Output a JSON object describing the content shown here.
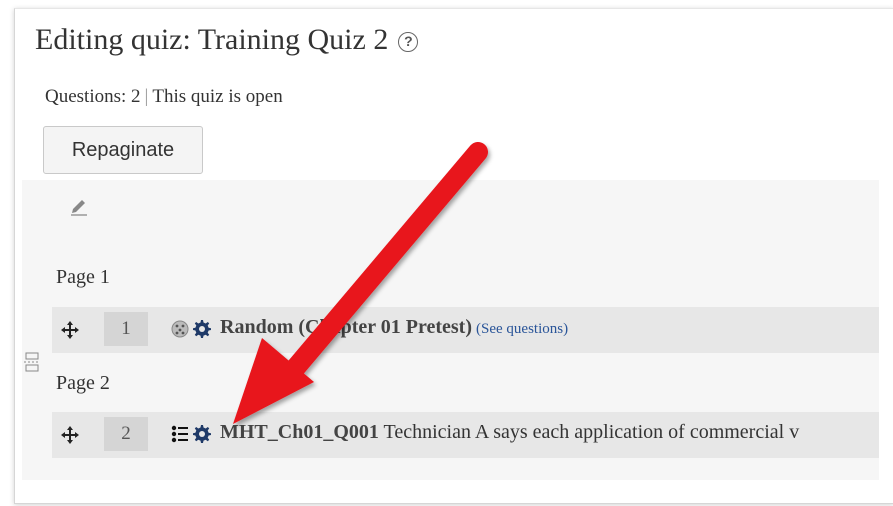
{
  "header": {
    "title": "Editing quiz: Training Quiz 2",
    "help_icon": "help-icon"
  },
  "status": {
    "questions": "Questions: 2",
    "separator": "|",
    "state": "This quiz is open"
  },
  "toolbar": {
    "repaginate_label": "Repaginate"
  },
  "pages": [
    {
      "label": "Page 1",
      "question": {
        "slot": "1",
        "icons": [
          "random-icon",
          "gear-icon"
        ],
        "name": "Random (Chapter 01 Pretest)",
        "link": "(See questions)",
        "text": ""
      }
    },
    {
      "label": "Page 2",
      "question": {
        "slot": "2",
        "icons": [
          "multichoice-icon",
          "gear-icon"
        ],
        "name": "MHT_Ch01_Q001",
        "text": "Technician A says each application of commercial v"
      }
    }
  ],
  "colors": {
    "arrow": "#e8131b",
    "link": "#2a5599",
    "row_bg": "#e7e7e7"
  }
}
